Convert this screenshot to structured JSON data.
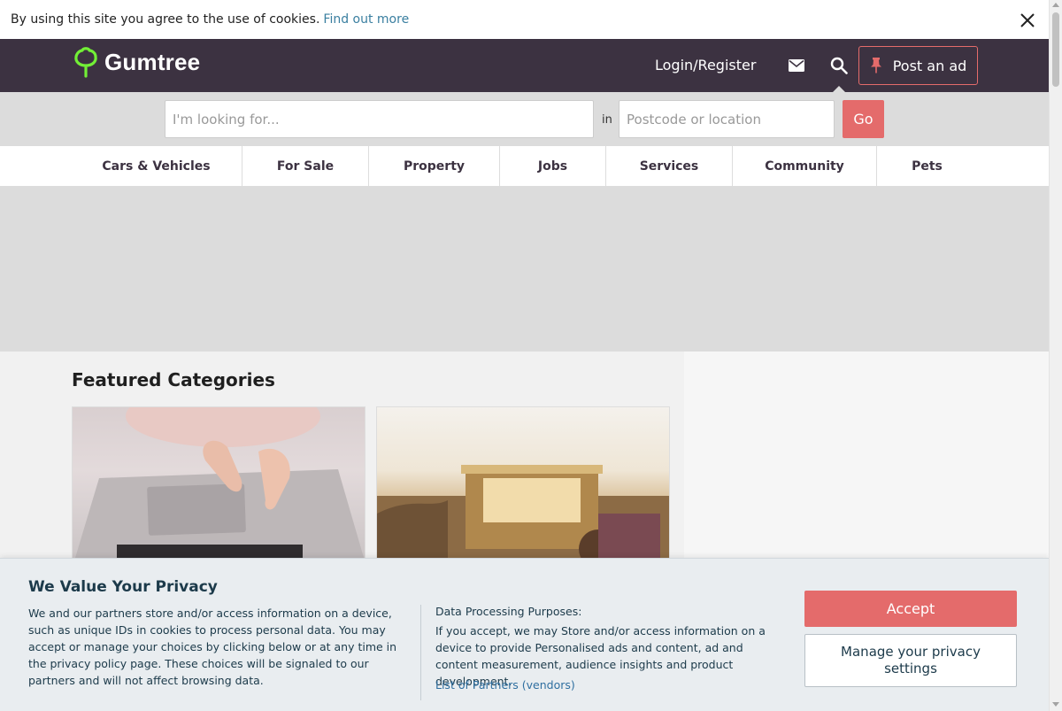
{
  "cookie_bar": {
    "text": "By using this site you agree to the use of cookies.",
    "link": "Find out more"
  },
  "header": {
    "logo_text": "Gumtree",
    "login": "Login/Register",
    "post_ad": "Post an ad"
  },
  "search": {
    "query_placeholder": "I'm looking for...",
    "in_label": "in",
    "location_placeholder": "Postcode or location",
    "go": "Go"
  },
  "categories": [
    "Cars & Vehicles",
    "For Sale",
    "Property",
    "Jobs",
    "Services",
    "Community",
    "Pets"
  ],
  "featured": {
    "title": "Featured Categories"
  },
  "privacy": {
    "title": "We Value Your Privacy",
    "body": "We and our partners store and/or access information on a device, such as unique IDs in cookies to process personal data. You may accept or manage your choices by clicking below or at any time in the privacy policy page. These choices will be signaled to our partners and will not affect browsing data.",
    "purposes_title": "Data Processing Purposes:",
    "purposes_body": "If you accept, we may Store and/or access information on a device to provide Personalised ads and content, ad and content measurement, audience insights and product development.",
    "partners_link": "List of Partners (vendors)",
    "accept": "Accept",
    "manage": "Manage your privacy settings"
  },
  "colors": {
    "header_bg": "#3c3241",
    "accent": "#e46b6b",
    "logo_green": "#72ef36",
    "link": "#3a7fa0"
  },
  "icons": [
    "close-icon",
    "gumtree-tree-icon",
    "mail-icon",
    "search-icon",
    "pin-icon"
  ]
}
